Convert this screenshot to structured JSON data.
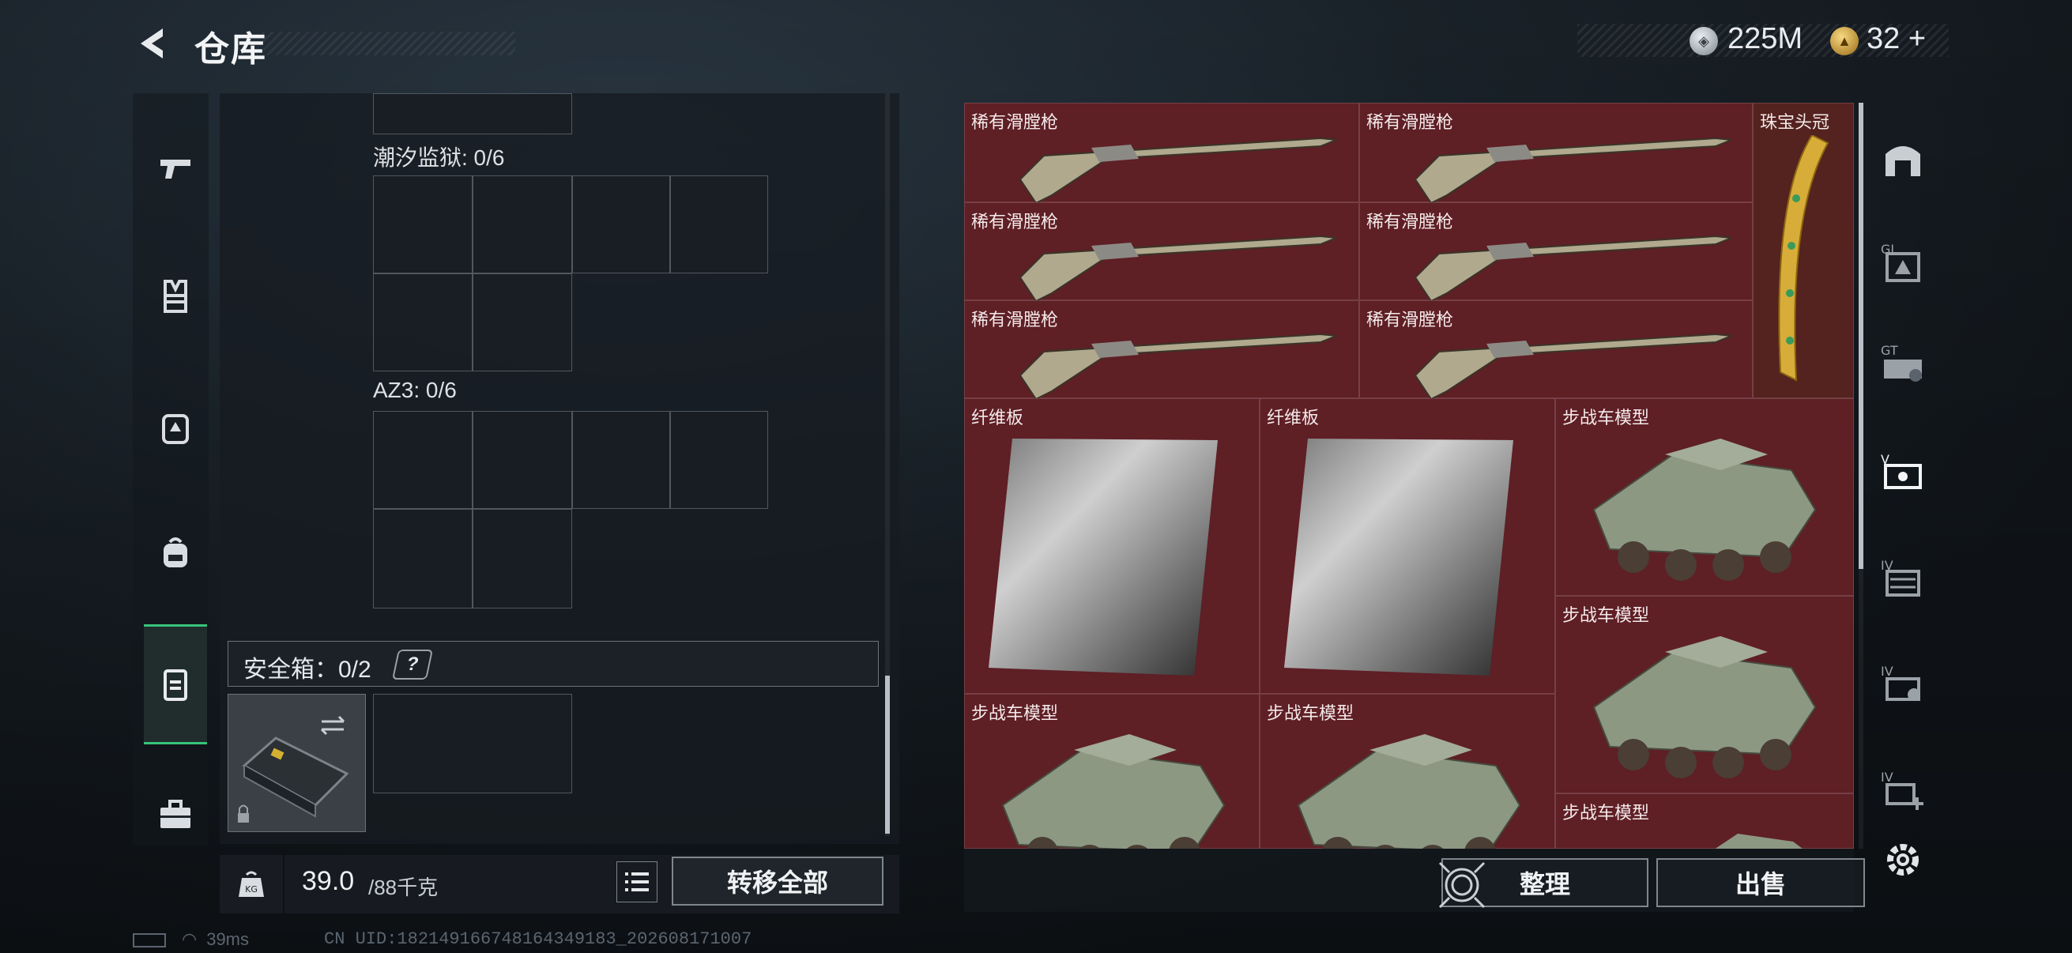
{
  "header": {
    "title": "仓库",
    "currency_silver": "225M",
    "currency_gold": "32",
    "currency_gold_add": "+"
  },
  "left_nav": {
    "items": [
      "weapon-icon",
      "vest-icon",
      "helmet-icon",
      "backpack-icon",
      "secure-case-icon",
      "toolbox-icon"
    ],
    "active_index": 4
  },
  "containers": {
    "tide_prison_label": "潮汐监狱: 0/6",
    "az3_label": "AZ3: 0/6",
    "secure_case_label": "安全箱：0/2",
    "secure_help": "?"
  },
  "bottom": {
    "weight_current": "39.0",
    "weight_max": "/88千克",
    "transfer_all": "转移全部",
    "sort": "整理",
    "sell": "出售"
  },
  "status": {
    "ping": "39ms",
    "uid": "CN UID:18214916674816434918​3_202608171007"
  },
  "stash_items": [
    {
      "name": "稀有滑膛枪",
      "type": "musket"
    },
    {
      "name": "稀有滑膛枪",
      "type": "musket"
    },
    {
      "name": "珠宝头冠",
      "type": "crown"
    },
    {
      "name": "稀有滑膛枪",
      "type": "musket"
    },
    {
      "name": "稀有滑膛枪",
      "type": "musket"
    },
    {
      "name": "稀有滑膛枪",
      "type": "musket"
    },
    {
      "name": "稀有滑膛枪",
      "type": "musket"
    },
    {
      "name": "纤维板",
      "type": "fiberboard"
    },
    {
      "name": "纤维板",
      "type": "fiberboard"
    },
    {
      "name": "步战车模型",
      "type": "ifv"
    },
    {
      "name": "步战车模型",
      "type": "ifv"
    },
    {
      "name": "步战车模型",
      "type": "ifv"
    },
    {
      "name": "步战车模型",
      "type": "ifv"
    },
    {
      "name": "步战车模型",
      "type": "ifv"
    }
  ],
  "right_nav": {
    "items": [
      "stash-tab-icon",
      "g-tab-1-icon",
      "g-tab-2-icon",
      "v-tab-icon",
      "iv-tab-1-icon",
      "iv-tab-2-icon",
      "iv-tab-add-icon"
    ],
    "active_index": 3
  },
  "colors": {
    "accent_green": "#38c47a",
    "stash_bg": "#5a1d22"
  }
}
